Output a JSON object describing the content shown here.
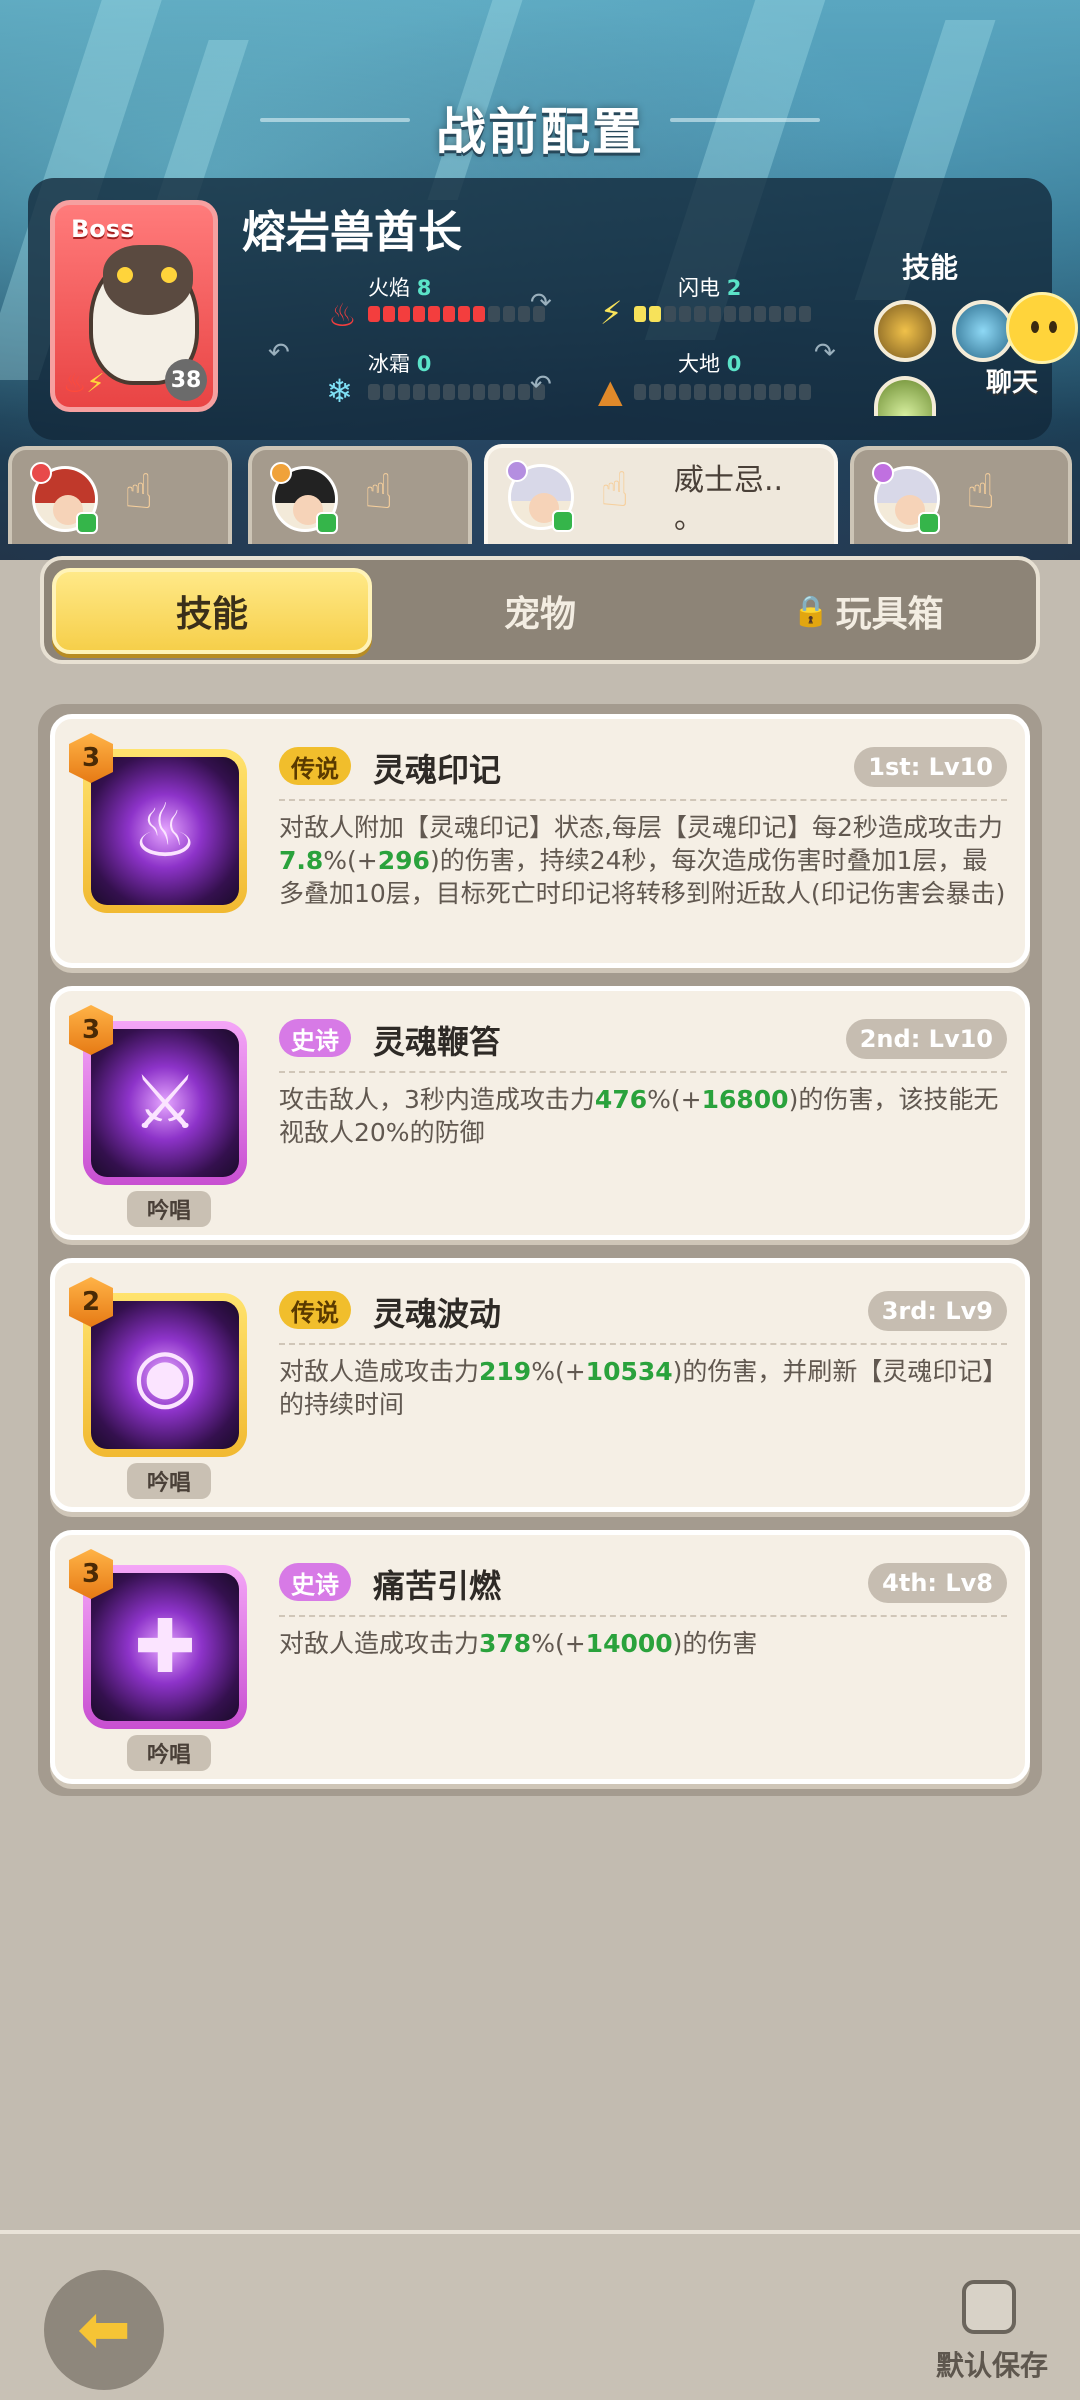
{
  "page": {
    "title": "战前配置"
  },
  "boss": {
    "tag": "Boss",
    "name": "熔岩兽酋长",
    "level": "38",
    "stats": {
      "fire": {
        "label": "火焰",
        "value": "8",
        "fill": 8,
        "max": 12
      },
      "lightning": {
        "label": "闪电",
        "value": "2",
        "fill": 2,
        "max": 12
      },
      "frost": {
        "label": "冰霜",
        "value": "0",
        "fill": 0,
        "max": 12
      },
      "earth": {
        "label": "大地",
        "value": "0",
        "fill": 0,
        "max": 12
      }
    },
    "skills_label": "技能"
  },
  "chat": {
    "label": "聊天"
  },
  "heroes": [
    {
      "name": "",
      "element_color": "#e84a4a",
      "hair_color": "#c0392b"
    },
    {
      "name": "",
      "element_color": "#f0a23a",
      "hair_color": "#222222"
    },
    {
      "name": "威士忌..\n。",
      "element_color": "#b48ee0",
      "hair_color": "#d8d8e8"
    },
    {
      "name": "",
      "element_color": "#c070e0",
      "hair_color": "#d8d8e8"
    }
  ],
  "tabs": {
    "skills": "技能",
    "pets": "宠物",
    "toybox": "玩具箱"
  },
  "skills": [
    {
      "rank": "3",
      "rarity": "传说",
      "rarity_type": "legend",
      "name": "灵魂印记",
      "level": "1st: Lv10",
      "chant": "",
      "desc_parts": [
        "对敌人附加【灵魂印记】状态,每层【灵魂印记】每2秒造成攻击力",
        "7.8",
        "%(+",
        "296",
        ")的伤害，持续24秒，每次造成伤害时叠加1层，最多叠加10层，目标死亡时印记将转移到附近敌人(印记伤害会暴击)"
      ],
      "glyph": "spiral-flame-icon"
    },
    {
      "rank": "3",
      "rarity": "史诗",
      "rarity_type": "epic",
      "name": "灵魂鞭笞",
      "level": "2nd: Lv10",
      "chant": "吟唱",
      "desc_parts": [
        "攻击敌人，3秒内造成攻击力",
        "476",
        "%(+",
        "16800",
        ")的伤害，该技能无视敌人20%的防御"
      ],
      "glyph": "whip-icon"
    },
    {
      "rank": "2",
      "rarity": "传说",
      "rarity_type": "legend",
      "name": "灵魂波动",
      "level": "3rd: Lv9",
      "chant": "吟唱",
      "desc_parts": [
        "对敌人造成攻击力",
        "219",
        "%(+",
        "10534",
        ")的伤害，并刷新【灵魂印记】的持续时间"
      ],
      "glyph": "vortex-icon"
    },
    {
      "rank": "3",
      "rarity": "史诗",
      "rarity_type": "epic",
      "name": "痛苦引燃",
      "level": "4th: Lv8",
      "chant": "吟唱",
      "desc_parts": [
        "对敌人造成攻击力",
        "378",
        "%(+",
        "14000",
        ")的伤害"
      ],
      "glyph": "burning-cross-icon"
    }
  ],
  "footer": {
    "save_label": "默认保存"
  }
}
